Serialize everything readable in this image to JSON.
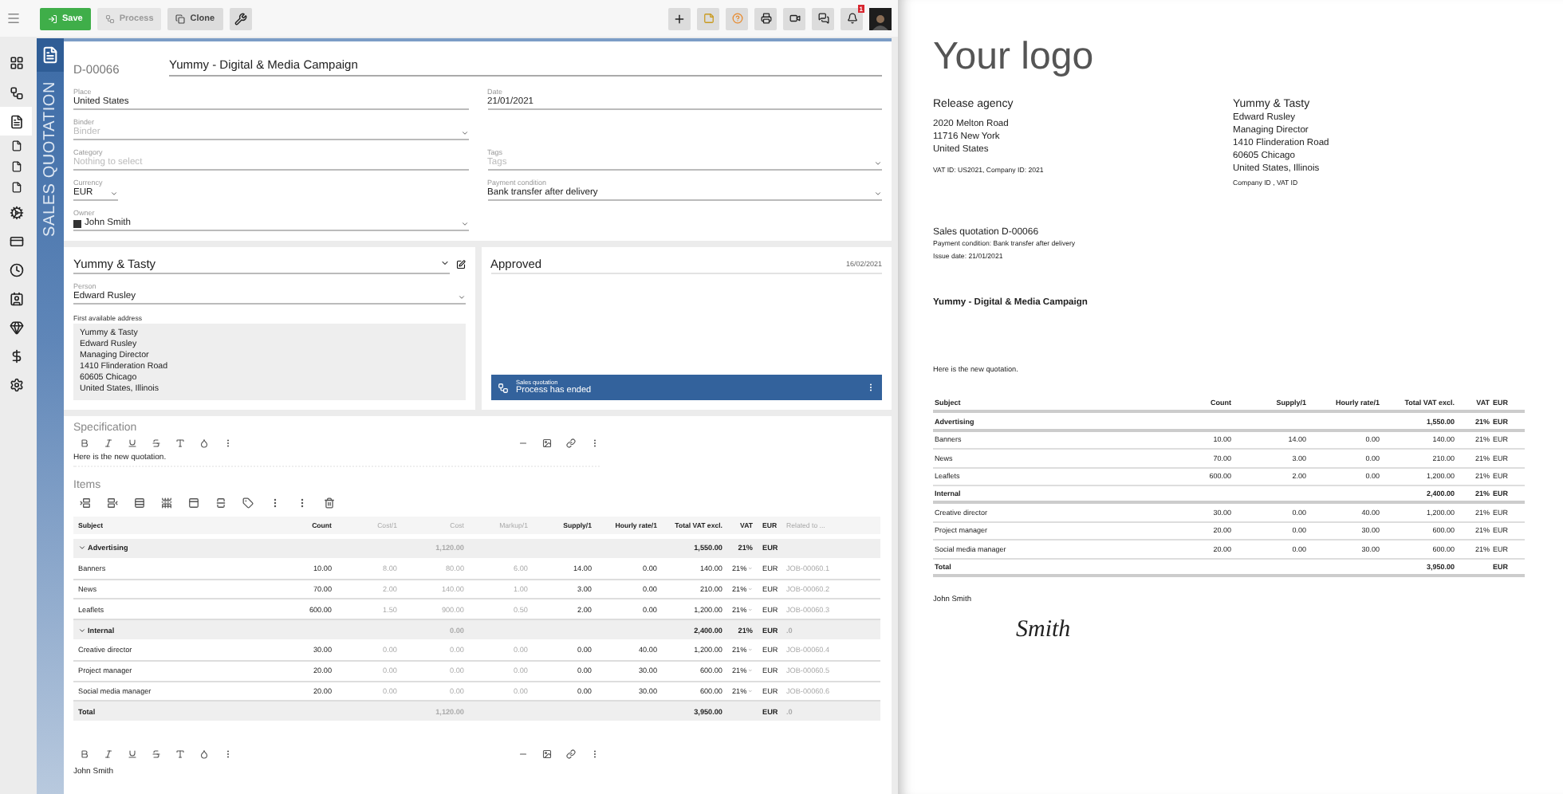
{
  "toolbar": {
    "buttons": [
      {
        "label": "Save",
        "kind": "primary",
        "disabled": false
      },
      {
        "label": "Process",
        "kind": "plain",
        "disabled": true
      },
      {
        "label": "Clone",
        "kind": "plain",
        "disabled": false
      }
    ],
    "notifications": "1"
  },
  "sidebar": [
    {
      "selected": false
    },
    {
      "selected": false
    },
    {
      "selected": true
    },
    {
      "selected": false
    },
    {
      "selected": false
    },
    {
      "selected": false
    },
    {
      "selected": false
    },
    {
      "selected": false
    },
    {
      "selected": false
    },
    {
      "selected": false
    },
    {
      "selected": false
    },
    {
      "selected": false
    },
    {
      "selected": false
    }
  ],
  "form": {
    "side_label": "SALES QUOTATION",
    "number": "D-00066",
    "title": "Yummy - Digital & Media Campaign",
    "rows": [
      {
        "left": {
          "label": "Place",
          "value": "United States",
          "kind": "text"
        },
        "right": {
          "label": "Date",
          "value": "21/01/2021",
          "kind": "text"
        }
      },
      {
        "left": {
          "label": "Binder",
          "placeholder": "Binder",
          "kind": "select"
        }
      },
      {
        "left": {
          "label": "Category",
          "placeholder": "Nothing to select",
          "kind": "text"
        },
        "right": {
          "label": "Tags",
          "placeholder": "Tags",
          "kind": "select"
        }
      },
      {
        "left": {
          "label": "Currency",
          "value": "EUR",
          "kind": "short"
        },
        "right": {
          "label": "Payment condition",
          "value": "Bank transfer after delivery",
          "kind": "select"
        }
      },
      {
        "left": {
          "label": "Owner",
          "value": "John Smith",
          "kind": "user"
        }
      }
    ]
  },
  "customer": {
    "company": "Yummy & Tasty",
    "person_label": "Person",
    "person": "Edward Rusley",
    "address_label": "First available address",
    "address": [
      "Yummy & Tasty",
      "Edward Rusley",
      "Managing Director",
      "1410 Flinderation Road",
      "60605 Chicago",
      "United States, Illinois"
    ]
  },
  "status": {
    "title": "Approved",
    "date": "16/02/2021",
    "process_label": "Sales quotation",
    "process_status": "Process has ended"
  },
  "specification": {
    "title": "Specification",
    "text": "Here is the new quotation."
  },
  "items": {
    "title": "Items",
    "columns": [
      {
        "label": "Subject",
        "muted": false
      },
      {
        "label": "Count",
        "muted": false
      },
      {
        "label": "Cost/1",
        "muted": true
      },
      {
        "label": "Cost",
        "muted": true
      },
      {
        "label": "Markup/1",
        "muted": true
      },
      {
        "label": "Supply/1",
        "muted": false
      },
      {
        "label": "Hourly rate/1",
        "muted": false
      },
      {
        "label": "Total VAT excl.",
        "muted": false
      },
      {
        "label": "VAT",
        "muted": false
      },
      {
        "label": "EUR",
        "muted": false
      },
      {
        "label": "Related to ...",
        "muted": true
      }
    ],
    "rows": [
      {
        "kind": "group",
        "expanded": true,
        "cells": [
          "Advertising",
          null,
          null,
          "1,120.00",
          null,
          null,
          null,
          "1,550.00",
          "21%",
          "EUR",
          null
        ]
      },
      {
        "kind": "item",
        "cells": [
          "Banners",
          "10.00",
          "8.00",
          "80.00",
          "6.00",
          "14.00",
          "0.00",
          "140.00",
          "21%",
          "EUR",
          "JOB-00060.1"
        ]
      },
      {
        "kind": "item",
        "cells": [
          "News",
          "70.00",
          "2.00",
          "140.00",
          "1.00",
          "3.00",
          "0.00",
          "210.00",
          "21%",
          "EUR",
          "JOB-00060.2"
        ]
      },
      {
        "kind": "item",
        "cells": [
          "Leaflets",
          "600.00",
          "1.50",
          "900.00",
          "0.50",
          "2.00",
          "0.00",
          "1,200.00",
          "21%",
          "EUR",
          "JOB-00060.3"
        ]
      },
      {
        "kind": "group",
        "expanded": true,
        "cells": [
          "Internal",
          null,
          null,
          "0.00",
          null,
          null,
          null,
          "2,400.00",
          "21%",
          "EUR",
          ".0"
        ]
      },
      {
        "kind": "item",
        "cells": [
          "Creative director",
          "30.00",
          "0.00",
          "0.00",
          "0.00",
          "0.00",
          "40.00",
          "1,200.00",
          "21%",
          "EUR",
          "JOB-00060.4"
        ]
      },
      {
        "kind": "item",
        "cells": [
          "Project manager",
          "20.00",
          "0.00",
          "0.00",
          "0.00",
          "0.00",
          "30.00",
          "600.00",
          "21%",
          "EUR",
          "JOB-00060.5"
        ]
      },
      {
        "kind": "item",
        "cells": [
          "Social media manager",
          "20.00",
          "0.00",
          "0.00",
          "0.00",
          "0.00",
          "30.00",
          "600.00",
          "21%",
          "EUR",
          "JOB-00060.6"
        ]
      },
      {
        "kind": "total",
        "cells": [
          "Total",
          null,
          null,
          "1,120.00",
          null,
          null,
          null,
          "3,950.00",
          null,
          "EUR",
          ".0"
        ]
      }
    ]
  },
  "footer_text": "John Smith",
  "document": {
    "logo": "Your logo",
    "sender": {
      "name": "Release agency",
      "lines": [
        "2020 Melton Road",
        "11716 New York",
        "United States"
      ],
      "ids": "VAT ID: US2021, Company ID: 2021"
    },
    "recipient": {
      "name": "Yummy & Tasty",
      "lines": [
        "Edward Rusley",
        "Managing Director",
        "1410 Flinderation Road",
        "60605 Chicago",
        "United States, Illinois"
      ],
      "ids": "Company ID , VAT ID"
    },
    "quote_title": "Sales quotation D-00066",
    "payment": "Payment condition: Bank transfer after delivery",
    "issue_date": "Issue date: 21/01/2021",
    "subject": "Yummy - Digital & Media Campaign",
    "intro": "Here is the new quotation.",
    "table": {
      "columns": [
        "Subject",
        "Count",
        "Supply/1",
        "Hourly rate/1",
        "Total VAT excl.",
        "VAT",
        "EUR"
      ],
      "rows": [
        {
          "kind": "group",
          "cells": [
            "Advertising",
            null,
            null,
            null,
            "1,550.00",
            "21%",
            "EUR"
          ]
        },
        {
          "kind": "item",
          "cells": [
            "Banners",
            "10.00",
            "14.00",
            "0.00",
            "140.00",
            "21%",
            "EUR"
          ]
        },
        {
          "kind": "item",
          "cells": [
            "News",
            "70.00",
            "3.00",
            "0.00",
            "210.00",
            "21%",
            "EUR"
          ]
        },
        {
          "kind": "item",
          "cells": [
            "Leaflets",
            "600.00",
            "2.00",
            "0.00",
            "1,200.00",
            "21%",
            "EUR"
          ]
        },
        {
          "kind": "group",
          "cells": [
            "Internal",
            null,
            null,
            null,
            "2,400.00",
            "21%",
            "EUR"
          ]
        },
        {
          "kind": "item",
          "cells": [
            "Creative director",
            "30.00",
            "0.00",
            "40.00",
            "1,200.00",
            "21%",
            "EUR"
          ]
        },
        {
          "kind": "item",
          "cells": [
            "Project manager",
            "20.00",
            "0.00",
            "30.00",
            "600.00",
            "21%",
            "EUR"
          ]
        },
        {
          "kind": "item",
          "cells": [
            "Social media manager",
            "20.00",
            "0.00",
            "30.00",
            "600.00",
            "21%",
            "EUR"
          ]
        },
        {
          "kind": "total",
          "cells": [
            "Total",
            null,
            null,
            null,
            "3,950.00",
            null,
            "EUR"
          ]
        }
      ]
    },
    "signer": "John Smith",
    "signature": "Smith"
  }
}
